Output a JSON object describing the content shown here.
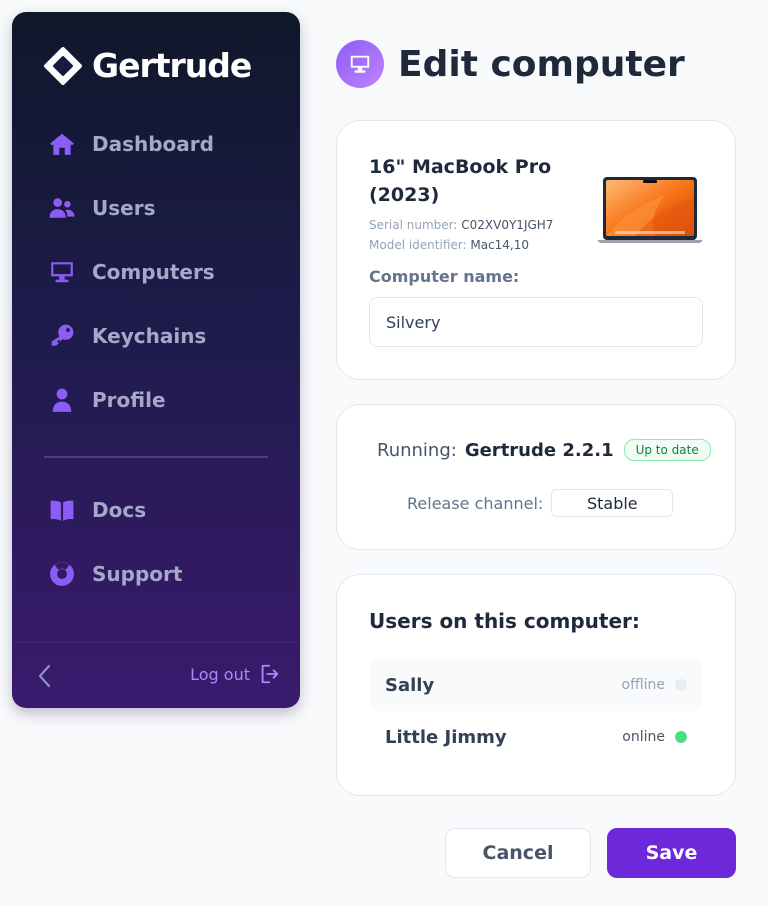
{
  "app": {
    "name": "Gertrude"
  },
  "sidebar": {
    "items": [
      {
        "label": "Dashboard",
        "icon": "home-icon"
      },
      {
        "label": "Users",
        "icon": "users-icon"
      },
      {
        "label": "Computers",
        "icon": "computer-icon"
      },
      {
        "label": "Keychains",
        "icon": "key-icon"
      },
      {
        "label": "Profile",
        "icon": "user-icon"
      },
      {
        "label": "Docs",
        "icon": "book-icon"
      },
      {
        "label": "Support",
        "icon": "lifebuoy-icon"
      }
    ],
    "logout_label": "Log out"
  },
  "page": {
    "title": "Edit computer",
    "title_icon": "computer-icon"
  },
  "computer": {
    "model": "16\" MacBook Pro (2023)",
    "serial_label": "Serial number:",
    "serial": "C02XV0Y1JGH7",
    "model_id_label": "Model identifier:",
    "model_id": "Mac14,10",
    "name_label": "Computer name:",
    "name_value": "Silvery"
  },
  "release": {
    "running_label": "Running:",
    "version": "Gertrude 2.2.1",
    "status_badge": "Up to date",
    "channel_label": "Release channel:",
    "channel_value": "Stable"
  },
  "users_section": {
    "title": "Users on this computer:",
    "users": [
      {
        "name": "Sally",
        "status": "offline"
      },
      {
        "name": "Little Jimmy",
        "status": "online"
      }
    ]
  },
  "actions": {
    "cancel_label": "Cancel",
    "save_label": "Save"
  },
  "colors": {
    "accent": "#6d28d9",
    "icon_purple": "#8b5cf6",
    "online": "#4ade80",
    "offline": "#e9edf2",
    "badge_green": "#15803d"
  }
}
